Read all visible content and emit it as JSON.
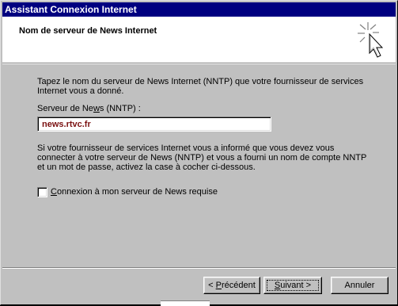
{
  "window": {
    "title": "Assistant Connexion Internet"
  },
  "header": {
    "title": "Nom de serveur de News Internet",
    "icon": "wizard-sparkle-cursor-icon"
  },
  "body": {
    "intro_text": "Tapez le nom du serveur de News Internet (NNTP) que votre fournisseur de services Internet vous a donné.",
    "field_label_before": "Serveur de Ne",
    "field_label_accel": "w",
    "field_label_after": "s (NNTP) :",
    "server_value": "news.rtvc.fr",
    "info_text": "Si votre fournisseur de services Internet vous a informé que vous devez vous connecter à votre serveur de News (NNTP) et vous a fourni un nom de compte NNTP et un mot de passe, activez la case à cocher ci-dessous.",
    "checkbox_label_before": "",
    "checkbox_label_accel": "C",
    "checkbox_label_after": "onnexion à mon serveur de News requise",
    "checkbox_checked": false
  },
  "buttons": {
    "prev_prefix": "< ",
    "prev_accel": "P",
    "prev_rest": "récédent",
    "next_accel": "S",
    "next_rest": "uivant >",
    "cancel": "Annuler"
  },
  "colors": {
    "titlebar": "#000080",
    "face": "#c0c0c0",
    "input_text": "#7a1010"
  }
}
